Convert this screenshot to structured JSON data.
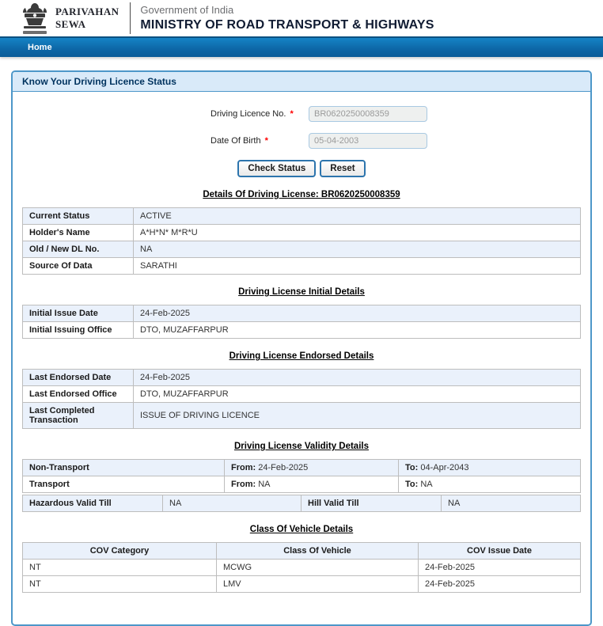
{
  "header": {
    "logo_line1": "PARIVAHAN",
    "logo_line2": "SEWA",
    "gov_label": "Government of India",
    "ministry": "MINISTRY OF ROAD TRANSPORT & HIGHWAYS"
  },
  "nav": {
    "items": [
      {
        "label": "Home"
      }
    ]
  },
  "panel": {
    "title": "Know Your Driving Licence Status"
  },
  "form": {
    "fields": [
      {
        "label": "Driving Licence No.",
        "required": "*",
        "value": "BR0620250008359"
      },
      {
        "label": "Date Of Birth",
        "required": "*",
        "value": "05-04-2003"
      }
    ],
    "buttons": [
      {
        "label": "Check Status"
      },
      {
        "label": "Reset"
      }
    ]
  },
  "sections": {
    "details": {
      "heading": "Details Of Driving License: BR0620250008359",
      "rows": [
        [
          "Current Status",
          "ACTIVE"
        ],
        [
          "Holder's Name",
          "A*H*N* M*R*U"
        ],
        [
          "Old / New DL No.",
          "NA"
        ],
        [
          "Source Of Data",
          "SARATHI"
        ]
      ]
    },
    "initial": {
      "heading": "Driving License Initial Details",
      "rows": [
        [
          "Initial Issue Date",
          "24-Feb-2025"
        ],
        [
          "Initial Issuing Office",
          "DTO, MUZAFFARPUR"
        ]
      ]
    },
    "endorsed": {
      "heading": "Driving License Endorsed Details",
      "rows": [
        [
          "Last Endorsed Date",
          "24-Feb-2025"
        ],
        [
          "Last Endorsed Office",
          "DTO, MUZAFFARPUR"
        ],
        [
          "Last Completed Transaction",
          "ISSUE OF DRIVING LICENCE"
        ]
      ]
    },
    "validity": {
      "heading": "Driving License Validity Details",
      "rows": [
        {
          "label": "Non-Transport",
          "from_label": "From:",
          "from": "24-Feb-2025",
          "to_label": "To:",
          "to": "04-Apr-2043"
        },
        {
          "label": "Transport",
          "from_label": "From:",
          "from": "NA",
          "to_label": "To:",
          "to": "NA"
        }
      ],
      "extra_row": {
        "label1": "Hazardous Valid Till",
        "value1": "NA",
        "label2": "Hill Valid Till",
        "value2": "NA"
      }
    },
    "cov": {
      "heading": "Class Of Vehicle Details",
      "columns": [
        "COV Category",
        "Class Of Vehicle",
        "COV Issue Date"
      ],
      "rows": [
        [
          "NT",
          "MCWG",
          "24-Feb-2025"
        ],
        [
          "NT",
          "LMV",
          "24-Feb-2025"
        ]
      ]
    }
  },
  "colors": {
    "navbar_blue": "#0d66a6",
    "panel_border": "#4d97c9",
    "panel_heading_bg": "#d9eaf9",
    "row_alt_bg": "#eaf1fb",
    "required_red": "#ff0000",
    "button_border": "#2c74ad",
    "ministry_navy": "#111c33"
  }
}
